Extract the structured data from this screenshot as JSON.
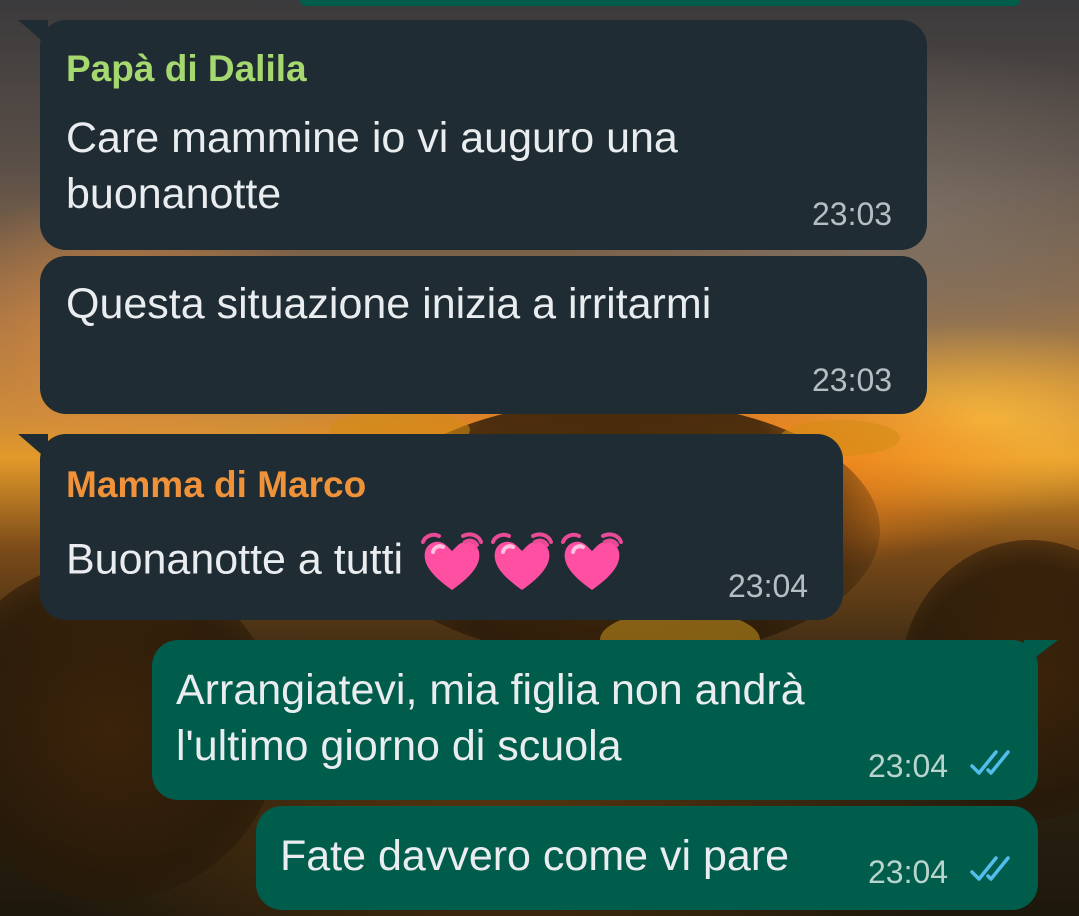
{
  "chat": {
    "messages": [
      {
        "direction": "incoming",
        "sender": "Papà di Dalila",
        "sender_color": "#a5d86e",
        "text": "Care mammine io vi auguro una\nbuonanotte",
        "time": "23:03"
      },
      {
        "direction": "incoming",
        "text": "Questa situazione inizia a irritarmi",
        "time": "23:03"
      },
      {
        "direction": "incoming",
        "sender": "Mamma di Marco",
        "sender_color": "#f0923a",
        "text": "Buonanotte a tutti",
        "emoji": [
          "beating-heart-icon",
          "beating-heart-icon",
          "beating-heart-icon"
        ],
        "time": "23:04"
      },
      {
        "direction": "outgoing",
        "text": "Arrangiatevi, mia figlia non andrà\nl'ultimo giorno di scuola",
        "time": "23:04",
        "status": "read-double-check-icon"
      },
      {
        "direction": "outgoing",
        "text": "Fate davvero come vi pare",
        "time": "23:04",
        "status": "read-double-check-icon"
      }
    ]
  },
  "colors": {
    "incoming_bubble": "#202c33",
    "outgoing_bubble": "#005c4b",
    "read_ticks": "#53bdeb",
    "heart": "#ff4fa3"
  }
}
